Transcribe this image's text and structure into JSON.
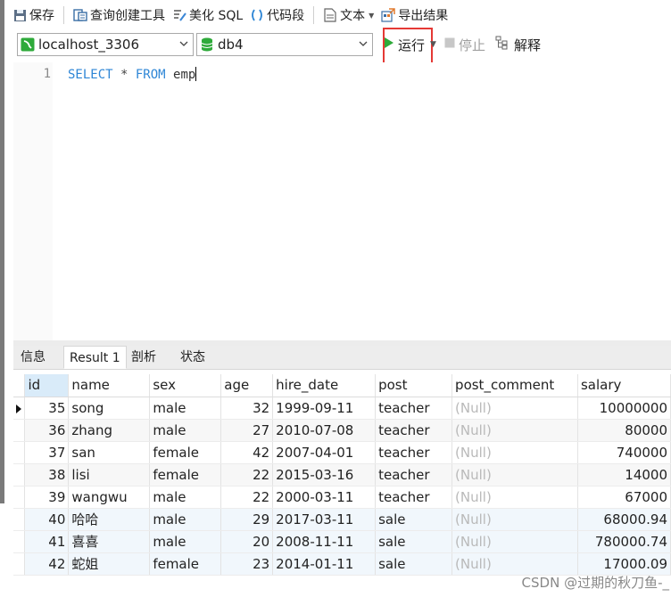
{
  "toolbar": {
    "save": "保存",
    "query_builder": "查询创建工具",
    "beautify": "美化 SQL",
    "snippet": "代码段",
    "text": "文本",
    "export": "导出结果"
  },
  "connection": {
    "value": "localhost_3306"
  },
  "database": {
    "value": "db4"
  },
  "actions": {
    "run": "运行",
    "stop": "停止",
    "explain": "解释"
  },
  "editor": {
    "line_number": "1",
    "kw_select": "SELECT",
    "star": " * ",
    "kw_from": "FROM",
    "table": " emp"
  },
  "result_tabs": [
    "信息",
    "Result 1",
    "剖析",
    "状态"
  ],
  "columns": [
    "id",
    "name",
    "sex",
    "age",
    "hire_date",
    "post",
    "post_comment",
    "salary"
  ],
  "rows": [
    [
      "35",
      "song",
      "male",
      "32",
      "1999-09-11",
      "teacher",
      "(Null)",
      "10000000"
    ],
    [
      "36",
      "zhang",
      "male",
      "27",
      "2010-07-08",
      "teacher",
      "(Null)",
      "80000"
    ],
    [
      "37",
      "san",
      "female",
      "42",
      "2007-04-01",
      "teacher",
      "(Null)",
      "740000"
    ],
    [
      "38",
      "lisi",
      "female",
      "22",
      "2015-03-16",
      "teacher",
      "(Null)",
      "14000"
    ],
    [
      "39",
      "wangwu",
      "male",
      "22",
      "2000-03-11",
      "teacher",
      "(Null)",
      "67000"
    ],
    [
      "40",
      "哈哈",
      "male",
      "29",
      "2017-03-11",
      "sale",
      "(Null)",
      "68000.94"
    ],
    [
      "41",
      "喜喜",
      "male",
      "20",
      "2008-11-11",
      "sale",
      "(Null)",
      "780000.74"
    ],
    [
      "42",
      "蛇姐",
      "female",
      "23",
      "2014-01-11",
      "sale",
      "(Null)",
      "17000.09"
    ]
  ],
  "watermark": "CSDN @过期的秋刀鱼-_",
  "colors": {
    "accent_keyword": "#2e86d6",
    "run_green": "#2eaa3a",
    "highlight_border": "#e53935"
  }
}
